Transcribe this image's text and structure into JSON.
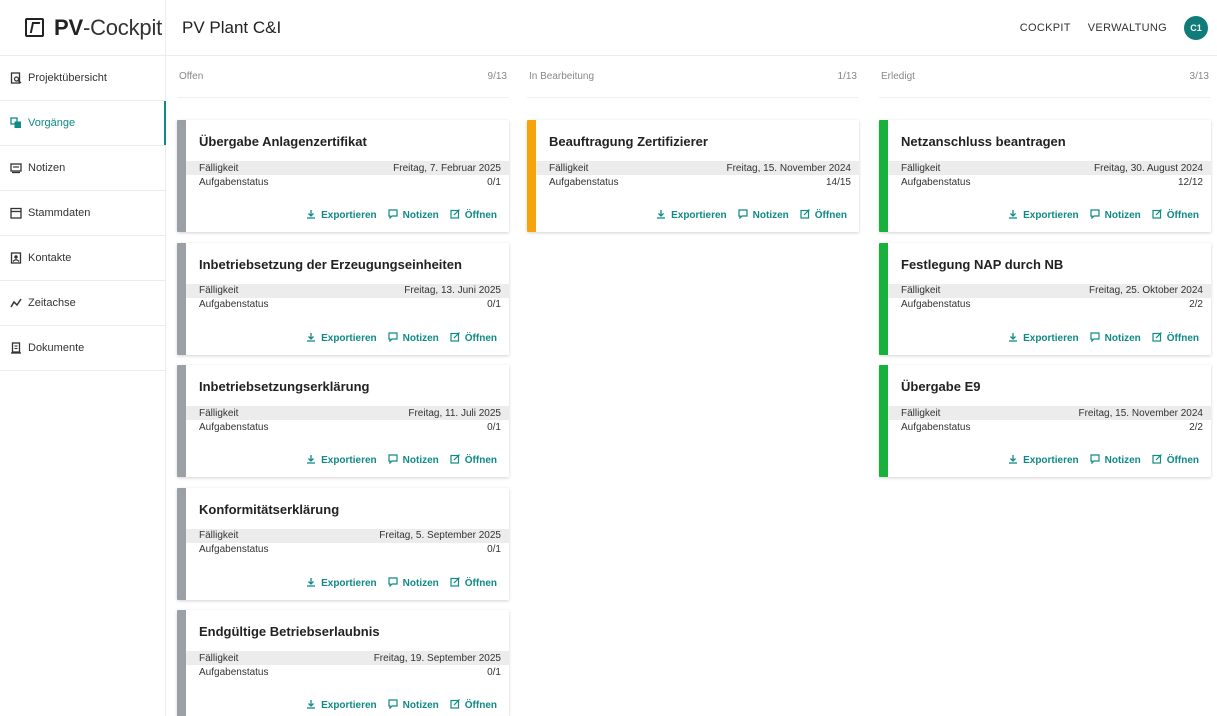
{
  "app": {
    "brand_bold": "PV",
    "brand_rest": "-Cockpit",
    "page_title": "PV Plant C&I"
  },
  "topnav": {
    "cockpit": "COCKPIT",
    "verwaltung": "VERWALTUNG",
    "avatar": "C1"
  },
  "colors": {
    "accent": "#0f8a86",
    "open": "#9aa0a6",
    "in_progress": "#f5a50b",
    "done": "#17b13c"
  },
  "sidebar": {
    "items": [
      {
        "label": "Projektübersicht",
        "icon": "project-overview-icon"
      },
      {
        "label": "Vorgänge",
        "icon": "tasks-icon",
        "active": true
      },
      {
        "label": "Notizen",
        "icon": "notes-icon"
      },
      {
        "label": "Stammdaten",
        "icon": "master-data-icon"
      },
      {
        "label": "Kontakte",
        "icon": "contacts-icon"
      },
      {
        "label": "Zeitachse",
        "icon": "timeline-icon"
      },
      {
        "label": "Dokumente",
        "icon": "documents-icon"
      }
    ]
  },
  "labels": {
    "due": "Fälligkeit",
    "task_status": "Aufgabenstatus",
    "export": "Exportieren",
    "notes": "Notizen",
    "open": "Öffnen"
  },
  "columns": [
    {
      "title": "Offen",
      "count": "9/13",
      "cards": [
        {
          "title": "Übergabe Anlagenzertifikat",
          "due": "Freitag, 7. Februar 2025",
          "status": "0/1"
        },
        {
          "title": "Inbetriebsetzung der Erzeugungseinheiten",
          "due": "Freitag, 13. Juni 2025",
          "status": "0/1"
        },
        {
          "title": "Inbetriebsetzungserklärung",
          "due": "Freitag, 11. Juli 2025",
          "status": "0/1"
        },
        {
          "title": "Konformitätserklärung",
          "due": "Freitag, 5. September 2025",
          "status": "0/1"
        },
        {
          "title": "Endgültige Betriebserlaubnis",
          "due": "Freitag, 19. September 2025",
          "status": "0/1"
        }
      ]
    },
    {
      "title": "In Bearbeitung",
      "count": "1/13",
      "cards": [
        {
          "title": "Beauftragung Zertifizierer",
          "due": "Freitag, 15. November 2024",
          "status": "14/15"
        }
      ]
    },
    {
      "title": "Erledigt",
      "count": "3/13",
      "cards": [
        {
          "title": "Netzanschluss beantragen",
          "due": "Freitag, 30. August 2024",
          "status": "12/12"
        },
        {
          "title": "Festlegung NAP durch NB",
          "due": "Freitag, 25. Oktober 2024",
          "status": "2/2"
        },
        {
          "title": "Übergabe E9",
          "due": "Freitag, 15. November 2024",
          "status": "2/2"
        }
      ]
    }
  ]
}
